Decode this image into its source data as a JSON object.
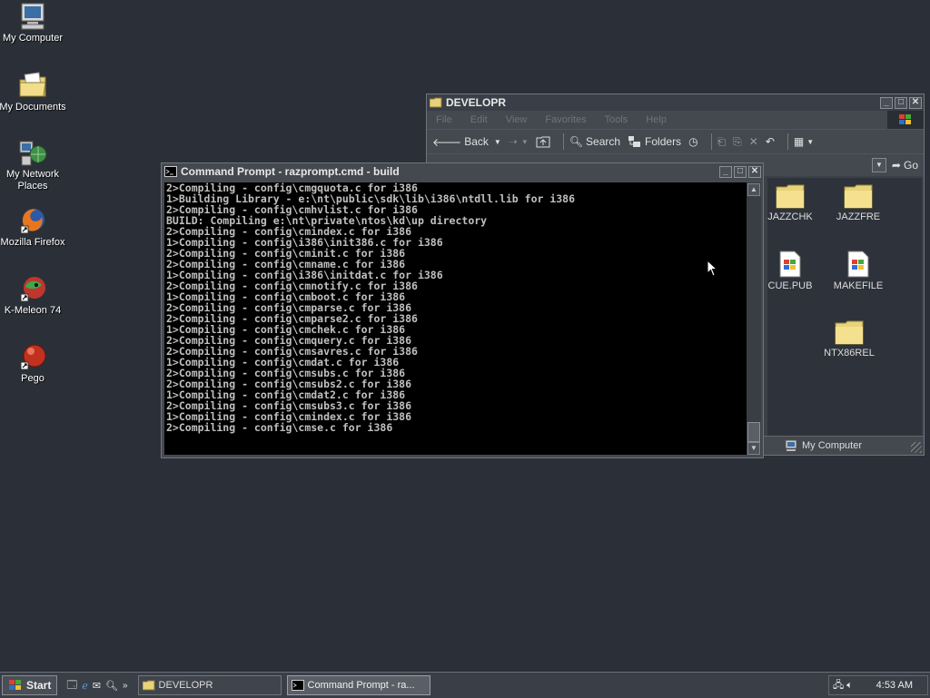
{
  "desktop": {
    "icons": [
      {
        "label": "My Computer"
      },
      {
        "label": "My Documents"
      },
      {
        "label": "My Network Places"
      },
      {
        "label": "Mozilla Firefox"
      },
      {
        "label": "K-Meleon 74"
      },
      {
        "label": "Pego"
      }
    ]
  },
  "explorer": {
    "title": "DEVELOPR",
    "menu": [
      "File",
      "Edit",
      "View",
      "Favorites",
      "Tools",
      "Help"
    ],
    "toolbar": {
      "back": "Back",
      "search": "Search",
      "folders": "Folders"
    },
    "go_label": "Go",
    "files": [
      {
        "name": "JAZZCHK",
        "type": "folder"
      },
      {
        "name": "JAZZFRE",
        "type": "folder"
      },
      {
        "name": "CUE.PUB",
        "type": "file"
      },
      {
        "name": "MAKEFILE",
        "type": "file"
      },
      {
        "name": "NTX86REL",
        "type": "folder"
      }
    ],
    "status_zone": "My Computer"
  },
  "cmd": {
    "title": "Command Prompt - razprompt.cmd - build",
    "lines": [
      "2>Compiling - config\\cmgquota.c for i386",
      "1>Building Library - e:\\nt\\public\\sdk\\lib\\i386\\ntdll.lib for i386",
      "2>Compiling - config\\cmhvlist.c for i386",
      "BUILD: Compiling e:\\nt\\private\\ntos\\kd\\up directory",
      "2>Compiling - config\\cmindex.c for i386",
      "1>Compiling - config\\i386\\init386.c for i386",
      "2>Compiling - config\\cminit.c for i386",
      "2>Compiling - config\\cmname.c for i386",
      "1>Compiling - config\\i386\\initdat.c for i386",
      "2>Compiling - config\\cmnotify.c for i386",
      "1>Compiling - config\\cmboot.c for i386",
      "2>Compiling - config\\cmparse.c for i386",
      "2>Compiling - config\\cmparse2.c for i386",
      "1>Compiling - config\\cmchek.c for i386",
      "2>Compiling - config\\cmquery.c for i386",
      "2>Compiling - config\\cmsavres.c for i386",
      "1>Compiling - config\\cmdat.c for i386",
      "2>Compiling - config\\cmsubs.c for i386",
      "2>Compiling - config\\cmsubs2.c for i386",
      "1>Compiling - config\\cmdat2.c for i386",
      "2>Compiling - config\\cmsubs3.c for i386",
      "1>Compiling - config\\cmindex.c for i386",
      "2>Compiling - config\\cmse.c for i386"
    ]
  },
  "taskbar": {
    "start_label": "Start",
    "tasks": [
      {
        "label": "DEVELOPR"
      },
      {
        "label": "Command Prompt - ra..."
      }
    ],
    "clock": "4:53 AM"
  },
  "colors": {
    "desktop_bg": "#2b3038",
    "console_bg": "#000000",
    "console_fg": "#c0c0c0"
  }
}
